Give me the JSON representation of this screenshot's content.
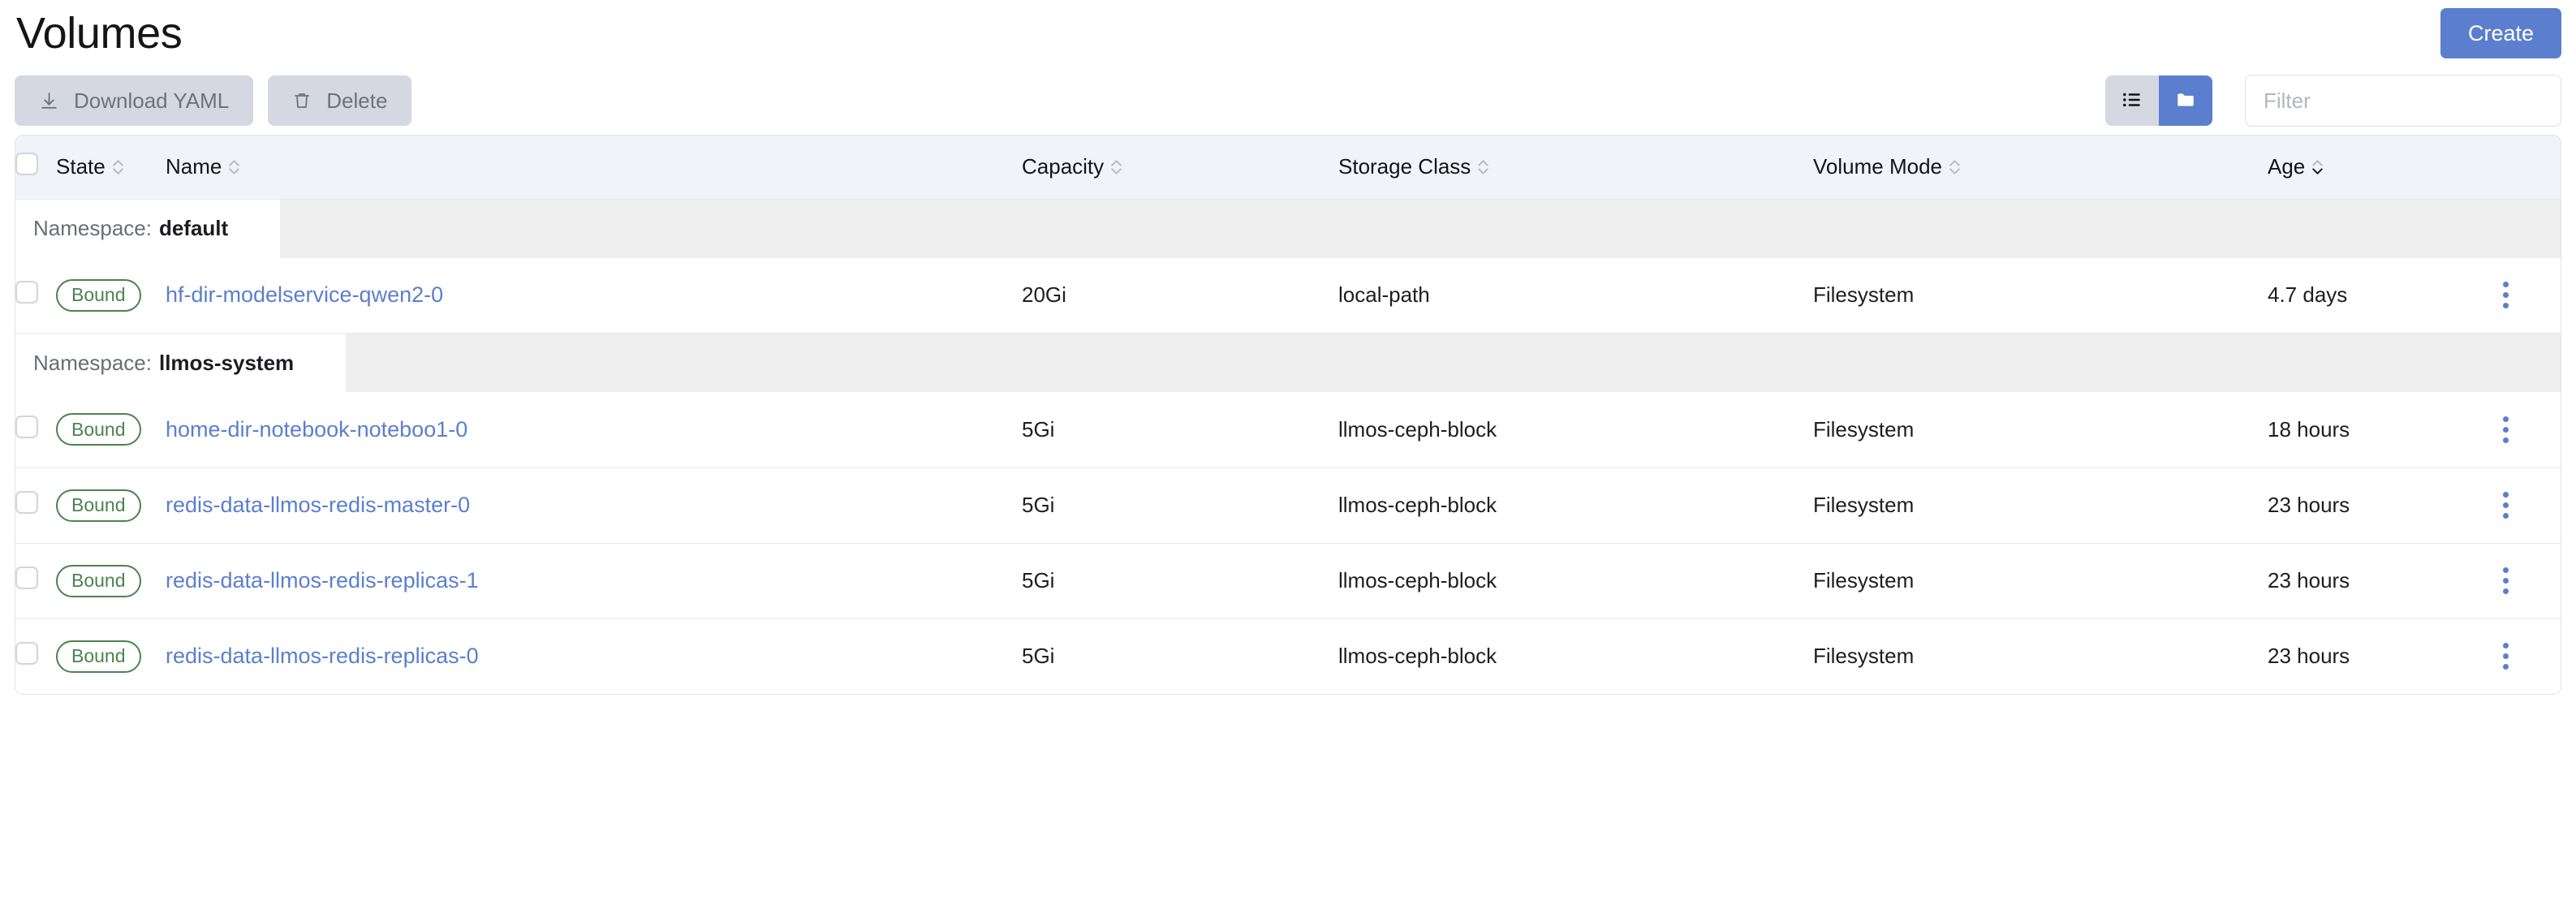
{
  "header": {
    "title": "Volumes",
    "create_label": "Create"
  },
  "toolbar": {
    "download_yaml_label": "Download YAML",
    "download_icon": "download-icon",
    "delete_label": "Delete",
    "delete_icon": "trash-icon",
    "view_list_icon": "list-view-icon",
    "view_group_icon": "folder-group-icon",
    "filter_placeholder": "Filter",
    "filter_value": ""
  },
  "table": {
    "columns": [
      {
        "key": "state",
        "label": "State",
        "sorted": false
      },
      {
        "key": "name",
        "label": "Name",
        "sorted": false
      },
      {
        "key": "capacity",
        "label": "Capacity",
        "sorted": false
      },
      {
        "key": "storage_class",
        "label": "Storage Class",
        "sorted": false
      },
      {
        "key": "volume_mode",
        "label": "Volume Mode",
        "sorted": false
      },
      {
        "key": "age",
        "label": "Age",
        "sorted": true,
        "direction": "desc"
      }
    ],
    "groups": [
      {
        "label_prefix": "Namespace:",
        "namespace": "default",
        "rows": [
          {
            "state": "Bound",
            "name": "hf-dir-modelservice-qwen2-0",
            "capacity": "20Gi",
            "storage_class": "local-path",
            "volume_mode": "Filesystem",
            "age": "4.7 days"
          }
        ]
      },
      {
        "label_prefix": "Namespace:",
        "namespace": "llmos-system",
        "rows": [
          {
            "state": "Bound",
            "name": "home-dir-notebook-noteboo1-0",
            "capacity": "5Gi",
            "storage_class": "llmos-ceph-block",
            "volume_mode": "Filesystem",
            "age": "18 hours"
          },
          {
            "state": "Bound",
            "name": "redis-data-llmos-redis-master-0",
            "capacity": "5Gi",
            "storage_class": "llmos-ceph-block",
            "volume_mode": "Filesystem",
            "age": "23 hours"
          },
          {
            "state": "Bound",
            "name": "redis-data-llmos-redis-replicas-1",
            "capacity": "5Gi",
            "storage_class": "llmos-ceph-block",
            "volume_mode": "Filesystem",
            "age": "23 hours"
          },
          {
            "state": "Bound",
            "name": "redis-data-llmos-redis-replicas-0",
            "capacity": "5Gi",
            "storage_class": "llmos-ceph-block",
            "volume_mode": "Filesystem",
            "age": "23 hours"
          }
        ]
      }
    ]
  },
  "colors": {
    "accent": "#5b7fce",
    "state_bound": "#4c8250",
    "toolbar_button": "#d5d8e0",
    "header_bg": "#f2f3f8",
    "group_bg": "#efefef"
  }
}
